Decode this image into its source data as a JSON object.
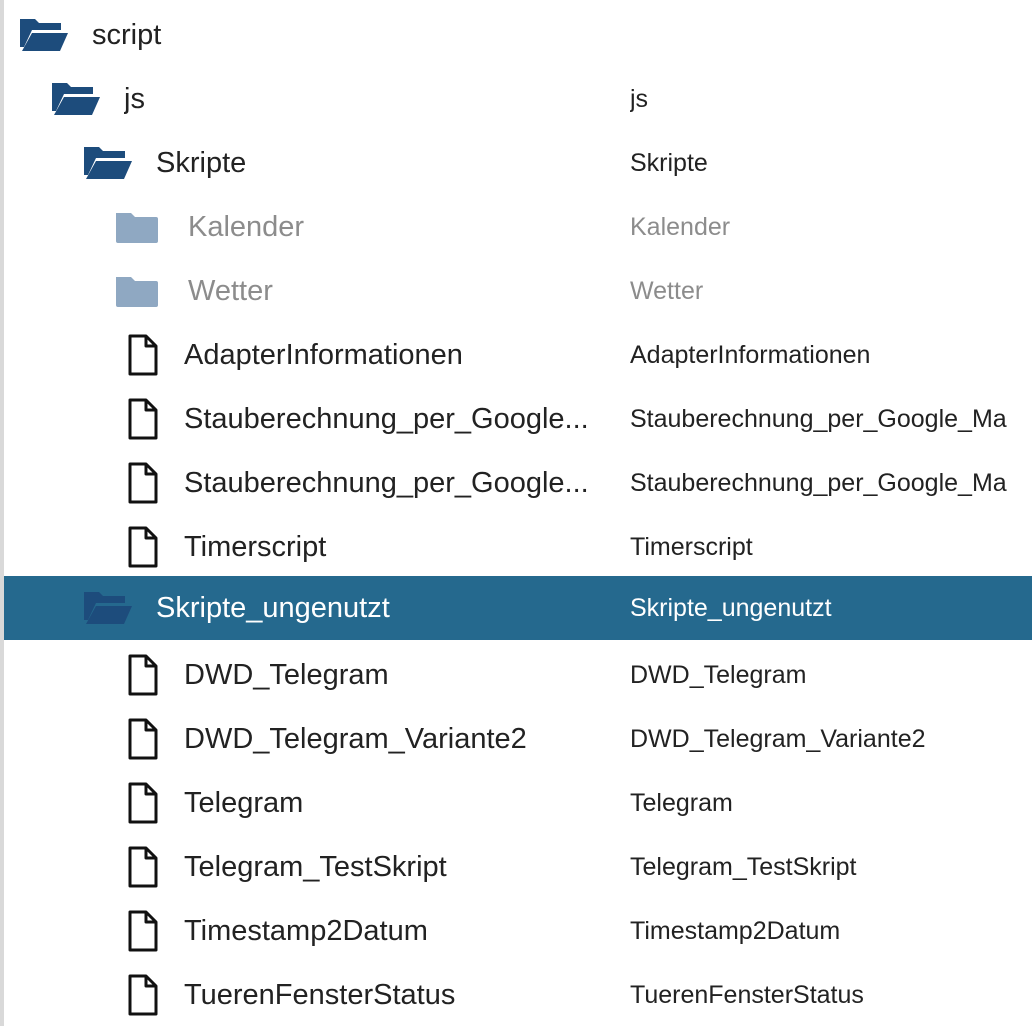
{
  "colors": {
    "folder_open": "#1d4c7c",
    "folder_disabled": "#8fa8c2",
    "selected_row": "#25698e",
    "text": "#222222",
    "text_disabled": "#8c8c8c"
  },
  "tree": {
    "rows": [
      {
        "name": "script",
        "title": "",
        "icon": "folder-open-icon",
        "state": "normal"
      },
      {
        "name": "js",
        "title": "js",
        "icon": "folder-open-icon",
        "state": "normal"
      },
      {
        "name": "Skripte",
        "title": "Skripte",
        "icon": "folder-open-icon",
        "state": "normal"
      },
      {
        "name": "Kalender",
        "title": "Kalender",
        "icon": "folder-closed-icon",
        "state": "disabled"
      },
      {
        "name": "Wetter",
        "title": "Wetter",
        "icon": "folder-closed-icon",
        "state": "disabled"
      },
      {
        "name": "AdapterInformationen",
        "title": "AdapterInformationen",
        "icon": "file-icon",
        "state": "normal"
      },
      {
        "name": "Stauberechnung_per_Google...",
        "title": "Stauberechnung_per_Google_Ma",
        "icon": "file-icon",
        "state": "normal"
      },
      {
        "name": "Stauberechnung_per_Google...",
        "title": "Stauberechnung_per_Google_Ma",
        "icon": "file-icon",
        "state": "normal"
      },
      {
        "name": "Timerscript",
        "title": "Timerscript",
        "icon": "file-icon",
        "state": "normal"
      },
      {
        "name": "Skripte_ungenutzt",
        "title": "Skripte_ungenutzt",
        "icon": "folder-open-icon",
        "state": "selected"
      },
      {
        "name": "DWD_Telegram",
        "title": "DWD_Telegram",
        "icon": "file-icon",
        "state": "normal"
      },
      {
        "name": "DWD_Telegram_Variante2",
        "title": "DWD_Telegram_Variante2",
        "icon": "file-icon",
        "state": "normal"
      },
      {
        "name": "Telegram",
        "title": "Telegram",
        "icon": "file-icon",
        "state": "normal"
      },
      {
        "name": "Telegram_TestSkript",
        "title": "Telegram_TestSkript",
        "icon": "file-icon",
        "state": "normal"
      },
      {
        "name": "Timestamp2Datum",
        "title": "Timestamp2Datum",
        "icon": "file-icon",
        "state": "normal"
      },
      {
        "name": "TuerenFensterStatus",
        "title": "TuerenFensterStatus",
        "icon": "file-icon",
        "state": "normal"
      }
    ]
  }
}
